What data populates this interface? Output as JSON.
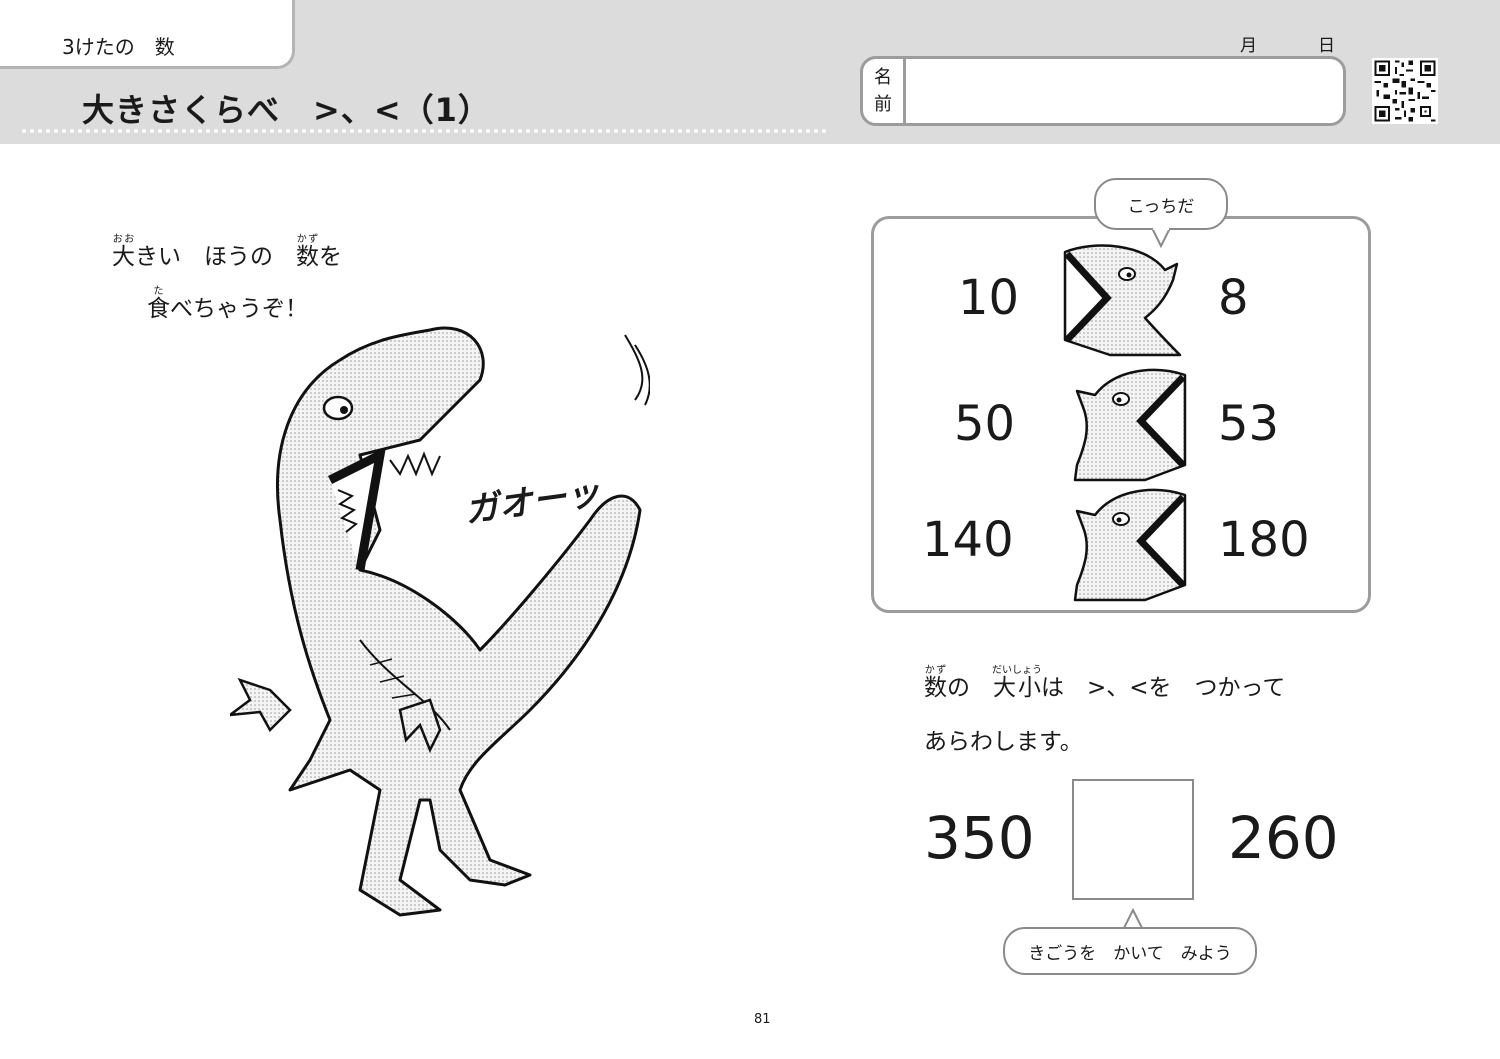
{
  "header": {
    "unit_label": "3けたの　数",
    "title": "大きさくらべ　>、<（1）",
    "date_month": "月",
    "date_day": "日",
    "name_label": [
      "名",
      "前"
    ]
  },
  "intro": {
    "line1": [
      {
        "base": "大",
        "ruby": "おお"
      },
      {
        "text": "きい　ほうの　"
      },
      {
        "base": "数",
        "ruby": "かず"
      },
      {
        "text": "を"
      }
    ],
    "line2": [
      {
        "base": "食",
        "ruby": "た"
      },
      {
        "text": "べちゃうぞ！"
      }
    ]
  },
  "roar": "ガオーッ",
  "example": {
    "bubble": "こっちだ",
    "rows": [
      {
        "left": "10",
        "right": "8"
      },
      {
        "left": "50",
        "right": "53"
      },
      {
        "left": "140",
        "right": "180"
      }
    ]
  },
  "rule": {
    "line1": [
      {
        "base": "数",
        "ruby": "かず"
      },
      {
        "text": "の　"
      },
      {
        "base": "大小",
        "ruby": "だいしょう"
      },
      {
        "text": "は　>、<を　つかって"
      }
    ],
    "line2": "あらわします。"
  },
  "exercise": {
    "left": "350",
    "right": "260",
    "hint": "きごうを　かいて　みよう"
  },
  "page_number": "81"
}
